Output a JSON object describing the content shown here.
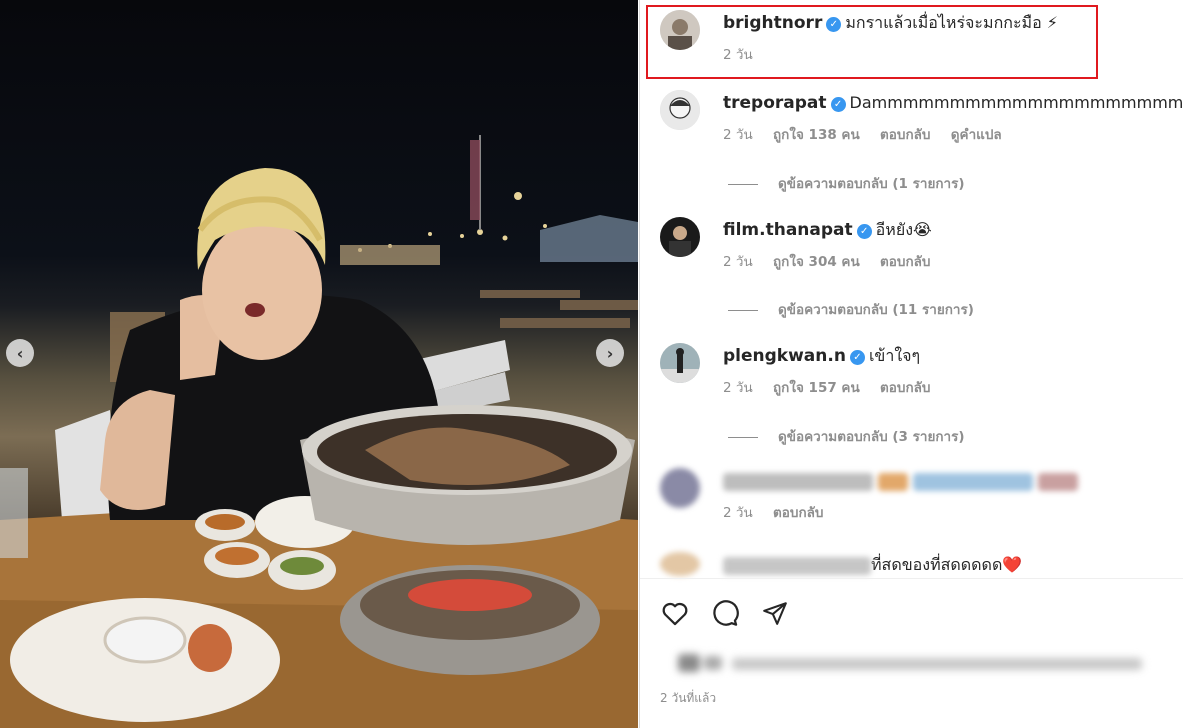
{
  "post": {
    "timestamp": "2 วันที่แล้ว"
  },
  "caption": {
    "username": "brightnorr",
    "text": "มกราแล้วเมื่อไหร่จะมกกะมือ ⚡",
    "time": "2 วัน"
  },
  "comments": [
    {
      "username": "treporapat",
      "text": "Dammmmmmmmmmmmmmmmmmmm🔥",
      "time": "2 วัน",
      "likes": "ถูกใจ 138 คน",
      "reply": "ตอบกลับ",
      "translate": "ดูคำแปล",
      "view_replies": "ดูข้อความตอบกลับ (1 รายการ)"
    },
    {
      "username": "film.thanapat",
      "text": "อีหยัง😭",
      "time": "2 วัน",
      "likes": "ถูกใจ 304 คน",
      "reply": "ตอบกลับ",
      "view_replies": "ดูข้อความตอบกลับ (11 รายการ)"
    },
    {
      "username": "plengkwan.n",
      "text": "เข้าใจๆ",
      "time": "2 วัน",
      "likes": "ถูกใจ 157 คน",
      "reply": "ตอบกลับ",
      "view_replies": "ดูข้อความตอบกลับ (3 รายการ)"
    },
    {
      "time": "2 วัน",
      "reply": "ตอบกลับ"
    },
    {
      "text": "ที่สดของที่สดดดดด❤️"
    }
  ],
  "icons": {
    "like": "heart-icon",
    "comment": "comment-icon",
    "share": "share-icon",
    "verified": "verified-badge-icon",
    "prev": "chevron-left-icon",
    "next": "chevron-right-icon"
  },
  "colors": {
    "highlight": "#e0191f",
    "verified": "#3897f0",
    "muted": "#8e8e8e"
  }
}
